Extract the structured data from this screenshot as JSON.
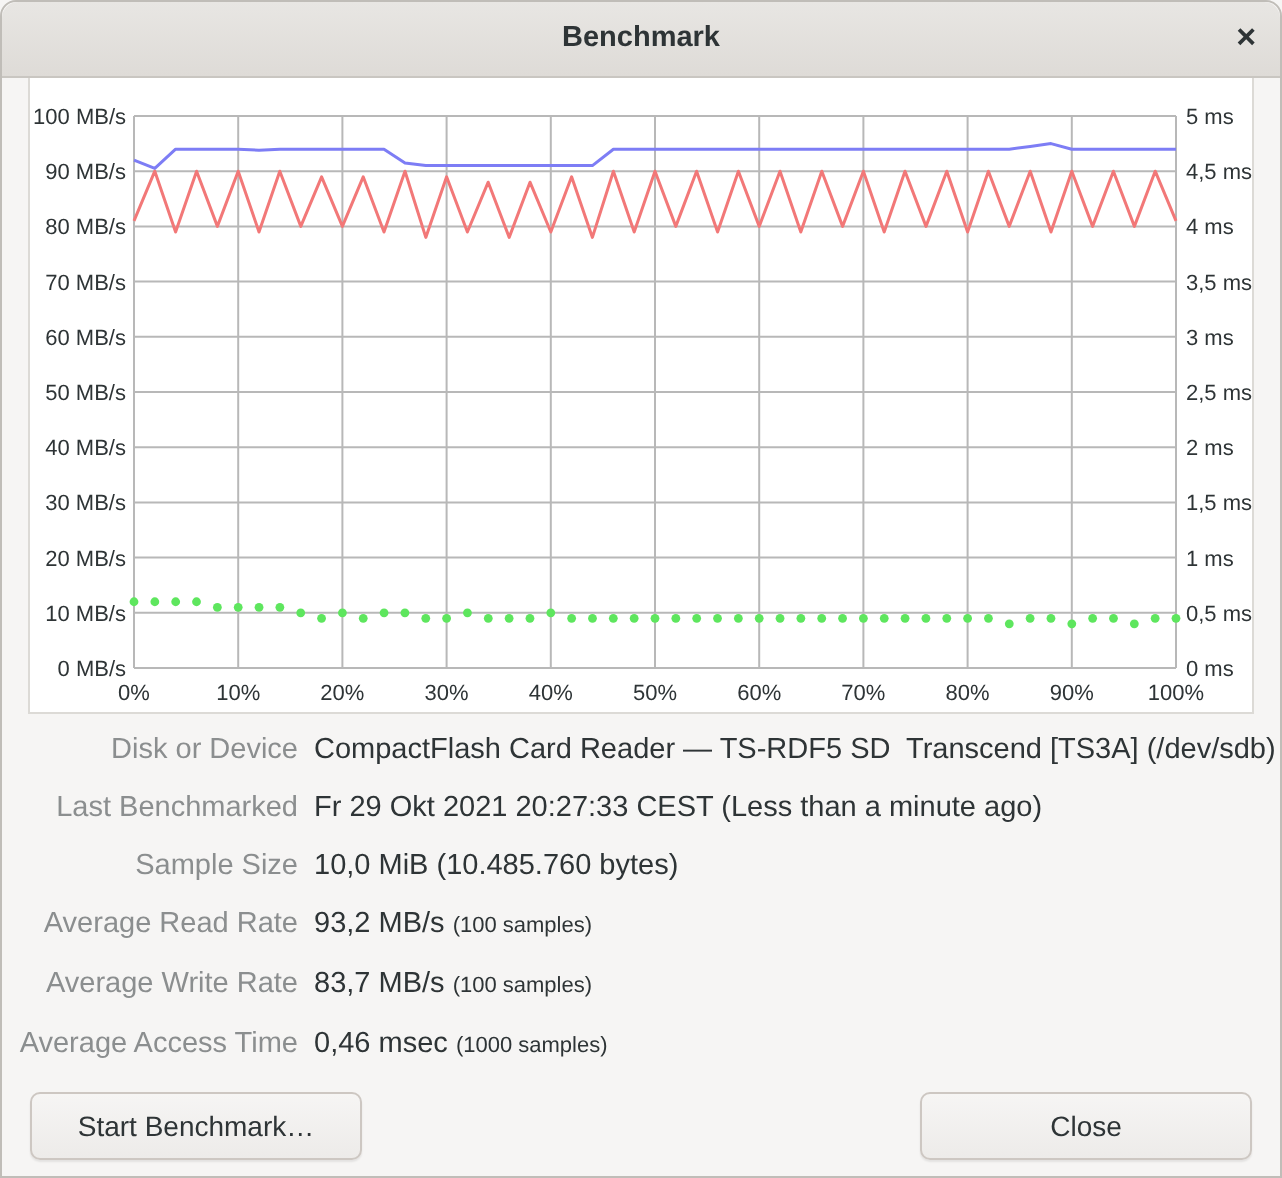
{
  "window": {
    "title": "Benchmark",
    "close": "×"
  },
  "chart": {
    "chart_data": {
      "type": "line",
      "grid": true,
      "xlim": [
        0,
        100
      ],
      "x": [
        0,
        2,
        4,
        6,
        8,
        10,
        12,
        14,
        16,
        18,
        20,
        22,
        24,
        26,
        28,
        30,
        32,
        34,
        36,
        38,
        40,
        42,
        44,
        46,
        48,
        50,
        52,
        54,
        56,
        58,
        60,
        62,
        64,
        66,
        68,
        70,
        72,
        74,
        76,
        78,
        80,
        82,
        84,
        86,
        88,
        90,
        92,
        94,
        96,
        98,
        100
      ],
      "xticks": [
        {
          "value": 0,
          "label": "0%"
        },
        {
          "value": 10,
          "label": "10%"
        },
        {
          "value": 20,
          "label": "20%"
        },
        {
          "value": 30,
          "label": "30%"
        },
        {
          "value": 40,
          "label": "40%"
        },
        {
          "value": 50,
          "label": "50%"
        },
        {
          "value": 60,
          "label": "60%"
        },
        {
          "value": 70,
          "label": "70%"
        },
        {
          "value": 80,
          "label": "80%"
        },
        {
          "value": 90,
          "label": "90%"
        },
        {
          "value": 100,
          "label": "100%"
        }
      ],
      "ylim": [
        0,
        100
      ],
      "yticks": [
        {
          "value": 0,
          "label": "0 MB/s"
        },
        {
          "value": 10,
          "label": "10 MB/s"
        },
        {
          "value": 20,
          "label": "20 MB/s"
        },
        {
          "value": 30,
          "label": "30 MB/s"
        },
        {
          "value": 40,
          "label": "40 MB/s"
        },
        {
          "value": 50,
          "label": "50 MB/s"
        },
        {
          "value": 60,
          "label": "60 MB/s"
        },
        {
          "value": 70,
          "label": "70 MB/s"
        },
        {
          "value": 80,
          "label": "80 MB/s"
        },
        {
          "value": 90,
          "label": "90 MB/s"
        },
        {
          "value": 100,
          "label": "100 MB/s"
        }
      ],
      "y2lim": [
        0,
        5
      ],
      "y2ticks": [
        {
          "value": 0,
          "label": "0 ms"
        },
        {
          "value": 0.5,
          "label": "0,5 ms"
        },
        {
          "value": 1,
          "label": "1 ms"
        },
        {
          "value": 1.5,
          "label": "1,5 ms"
        },
        {
          "value": 2,
          "label": "2 ms"
        },
        {
          "value": 2.5,
          "label": "2,5 ms"
        },
        {
          "value": 3,
          "label": "3 ms"
        },
        {
          "value": 3.5,
          "label": "3,5 ms"
        },
        {
          "value": 4,
          "label": "4 ms"
        },
        {
          "value": 4.5,
          "label": "4,5 ms"
        },
        {
          "value": 5,
          "label": "5 ms"
        }
      ],
      "series": [
        {
          "color": "#7d7df5",
          "values": [
            92,
            90.5,
            94,
            94,
            94,
            94,
            93.8,
            94,
            94,
            94,
            94,
            94,
            94,
            91.5,
            91,
            91,
            91,
            91,
            91,
            91,
            91,
            91,
            91,
            94,
            94,
            94,
            94,
            94,
            94,
            94,
            94,
            94,
            94,
            94,
            94,
            94,
            94,
            94,
            94,
            94,
            94,
            94,
            94,
            94.5,
            95,
            94,
            94,
            94,
            94,
            94,
            94
          ]
        },
        {
          "color": "#f27878",
          "values": [
            81,
            90,
            79,
            90,
            80,
            90,
            79,
            90,
            80,
            89,
            80,
            89,
            79,
            90,
            78,
            89,
            79,
            88,
            78,
            88,
            79,
            89,
            78,
            90,
            79,
            90,
            80,
            90,
            79,
            90,
            80,
            90,
            79,
            90,
            80,
            90,
            79,
            90,
            80,
            90,
            79,
            90,
            80,
            90,
            79,
            90,
            80,
            90,
            80,
            90,
            81
          ]
        },
        {
          "type": "scatter",
          "axis": "y2",
          "color": "#5ee65e",
          "values": [
            0.6,
            0.6,
            0.6,
            0.6,
            0.55,
            0.55,
            0.55,
            0.55,
            0.5,
            0.45,
            0.5,
            0.45,
            0.5,
            0.5,
            0.45,
            0.45,
            0.5,
            0.45,
            0.45,
            0.45,
            0.5,
            0.45,
            0.45,
            0.45,
            0.45,
            0.45,
            0.45,
            0.45,
            0.45,
            0.45,
            0.45,
            0.45,
            0.45,
            0.45,
            0.45,
            0.45,
            0.45,
            0.45,
            0.45,
            0.45,
            0.45,
            0.45,
            0.4,
            0.45,
            0.45,
            0.4,
            0.45,
            0.45,
            0.4,
            0.45,
            0.45
          ]
        }
      ]
    }
  },
  "details": [
    {
      "label": "Disk or Device",
      "value": "CompactFlash Card Reader — TS-RDF5 SD  Transcend [TS3A] (/dev/sdb)"
    },
    {
      "label": "Last Benchmarked",
      "value": "Fr 29 Okt 2021 20:27:33 CEST (Less than a minute ago)"
    },
    {
      "label": "Sample Size",
      "value": "10,0 MiB (10.485.760 bytes)"
    },
    {
      "label": "Average Read Rate",
      "value": "93,2 MB/s",
      "note": "(100 samples)"
    },
    {
      "label": "Average Write Rate",
      "value": "83,7 MB/s",
      "note": "(100 samples)"
    },
    {
      "label": "Average Access Time",
      "value": "0,46 msec",
      "note": "(1000 samples)"
    }
  ],
  "buttons": [
    {
      "label": "Start Benchmark…"
    },
    {
      "label": "Close"
    }
  ]
}
